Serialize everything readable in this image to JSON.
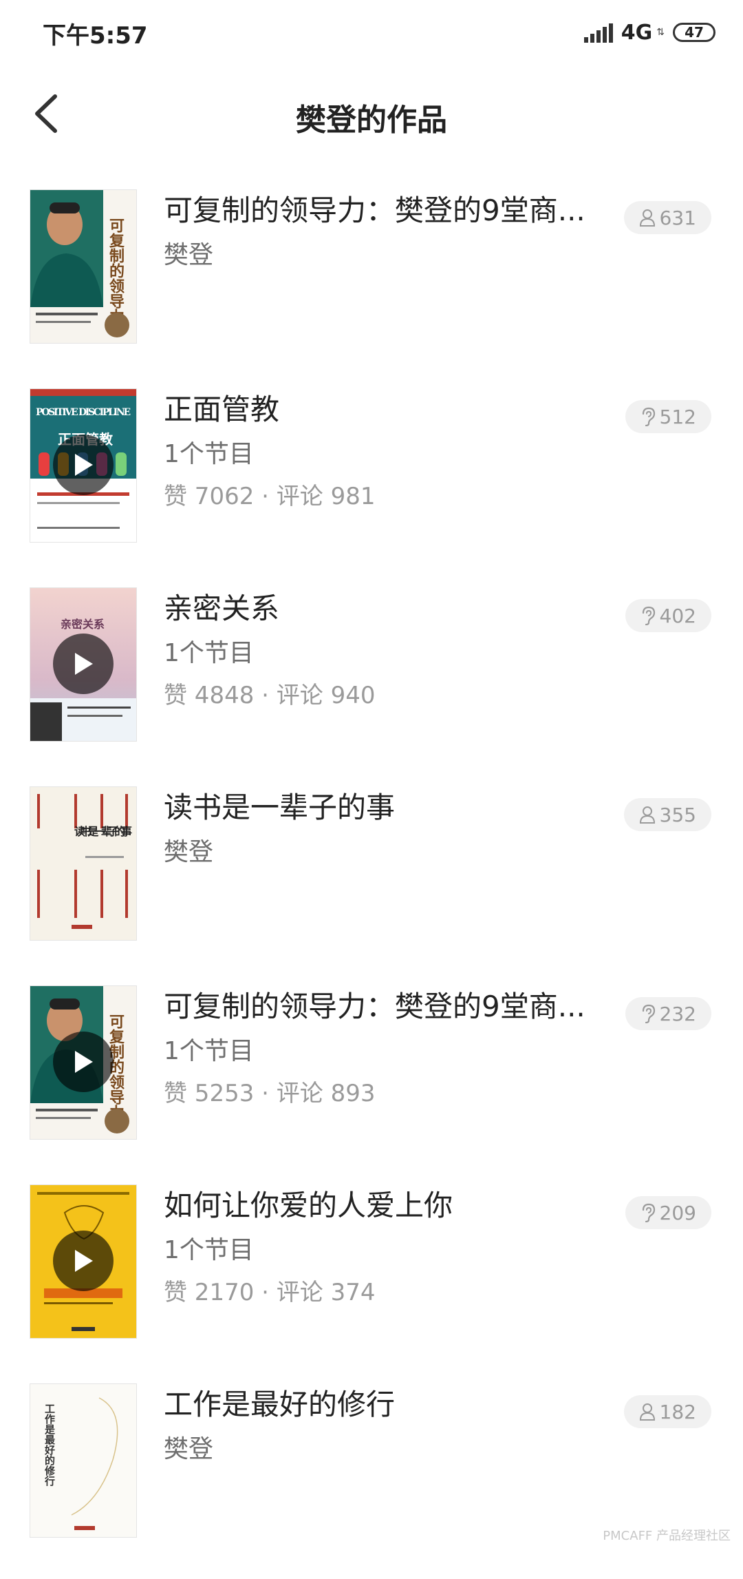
{
  "status_bar": {
    "time": "下午5:57",
    "network": "4G",
    "battery": "47"
  },
  "header": {
    "title": "樊登的作品"
  },
  "items": [
    {
      "title": "可复制的领导力：樊登的9堂商...",
      "subtitle": "樊登",
      "meta": "",
      "badge_icon": "person-icon",
      "count": "631",
      "has_play": false
    },
    {
      "title": "正面管教",
      "subtitle": "1个节目",
      "meta": "赞 7062 · 评论 981",
      "badge_icon": "ear-icon",
      "count": "512",
      "has_play": true
    },
    {
      "title": "亲密关系",
      "subtitle": "1个节目",
      "meta": "赞 4848 · 评论 940",
      "badge_icon": "ear-icon",
      "count": "402",
      "has_play": true
    },
    {
      "title": "读书是一辈子的事",
      "subtitle": "樊登",
      "meta": "",
      "badge_icon": "person-icon",
      "count": "355",
      "has_play": false
    },
    {
      "title": "可复制的领导力：樊登的9堂商...",
      "subtitle": "1个节目",
      "meta": "赞 5253 · 评论 893",
      "badge_icon": "ear-icon",
      "count": "232",
      "has_play": true
    },
    {
      "title": "如何让你爱的人爱上你",
      "subtitle": "1个节目",
      "meta": "赞 2170 · 评论 374",
      "badge_icon": "ear-icon",
      "count": "209",
      "has_play": true
    },
    {
      "title": "工作是最好的修行",
      "subtitle": "樊登",
      "meta": "",
      "badge_icon": "person-icon",
      "count": "182",
      "has_play": false
    }
  ],
  "covers": [
    {
      "style": "leadership",
      "text": "可复制的领导力"
    },
    {
      "style": "positive",
      "text_en": "POSITIVE DISCIPLINE",
      "text": "正面管教"
    },
    {
      "style": "intimacy",
      "text": "亲密关系"
    },
    {
      "style": "reading",
      "text": "读书是一辈子的事"
    },
    {
      "style": "leadership",
      "text": "可复制的领导力"
    },
    {
      "style": "love",
      "text": ""
    },
    {
      "style": "work",
      "text": "工作是最好的修行"
    }
  ],
  "watermark": "PMCAFF 产品经理社区"
}
